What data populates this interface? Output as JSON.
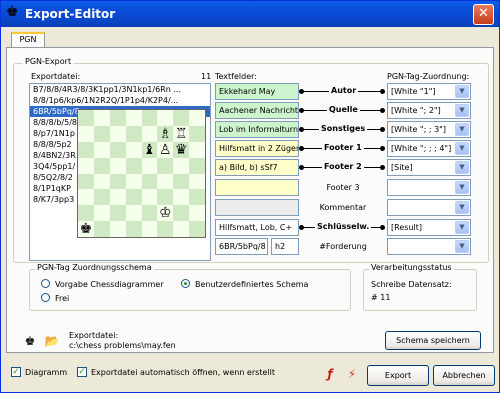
{
  "window": {
    "title": "Export-Editor",
    "close_glyph": "✕",
    "app_icon": "king-icon"
  },
  "tabs": [
    {
      "label": "PGN"
    }
  ],
  "pgn_export": {
    "group_label": "PGN-Export",
    "exportdatei_label": "Exportdatei:",
    "count": "11",
    "files": [
      "B7/8/8/4R3/8/3K1pp1/3N1kp1/6Rn ...",
      "8/8/1p6/kp6/1N2R2Q/1P1p4/K2P4/...",
      "6BR/5bPq/8",
      "8/8/8/b/5/8",
      "8/p7/1N1p",
      "8/8/8/5p2",
      "8/4BN2/3R",
      "3Q4/5pp1/",
      "8/5Q2/8/2",
      "8/1P1qKP",
      "8/K7/3pp3"
    ],
    "selected_index": 2
  },
  "board": {
    "pieces": [
      {
        "square": "f7",
        "glyph": "♗",
        "color": "white"
      },
      {
        "square": "g7",
        "glyph": "♖",
        "color": "white"
      },
      {
        "square": "e6",
        "glyph": "♝",
        "color": "black"
      },
      {
        "square": "f6",
        "glyph": "♙",
        "color": "white"
      },
      {
        "square": "g6",
        "glyph": "♛",
        "color": "black"
      },
      {
        "square": "f2",
        "glyph": "♔",
        "color": "white"
      },
      {
        "square": "a1",
        "glyph": "♚",
        "color": "black"
      }
    ]
  },
  "textfields": {
    "label": "Textfelder:",
    "fields": [
      {
        "value": "Ekkehard May",
        "bg": "green"
      },
      {
        "value": "Aachener Nachricht",
        "bg": "green"
      },
      {
        "value": "Lob im Informalturnie",
        "bg": "green"
      },
      {
        "value": "Hilfsmatt in 2 Zügen",
        "bg": "yellow"
      },
      {
        "value": "a) Bild, b) sSf7",
        "bg": "yellow"
      },
      {
        "value": "",
        "bg": "yellow"
      },
      {
        "value": "",
        "bg": "grey"
      },
      {
        "value": "Hilfsmatt, Lob, C+",
        "bg": "white"
      }
    ],
    "fen": "6BR/5bPq/8",
    "fen_suffix": "h2"
  },
  "tag_mapping": {
    "label": "PGN-Tag-Zuordnung:",
    "rows": [
      {
        "name": "Autor",
        "bold": true,
        "select": "[White \"1\"]"
      },
      {
        "name": "Quelle",
        "bold": true,
        "select": "[White \"; 2\"]"
      },
      {
        "name": "Sonstiges",
        "bold": true,
        "select": "[White \"; ; 3\"]"
      },
      {
        "name": "Footer 1",
        "bold": true,
        "select": "[White \"; ; ; 4\"]"
      },
      {
        "name": "Footer 2",
        "bold": true,
        "select": "[Site]"
      },
      {
        "name": "Footer 3",
        "bold": false,
        "select": ""
      },
      {
        "name": "Kommentar",
        "bold": false,
        "select": ""
      },
      {
        "name": "Schlüsselw.",
        "bold": true,
        "select": "[Result]"
      },
      {
        "name": "#Forderung",
        "bold": false,
        "select": ""
      }
    ]
  },
  "schema": {
    "group_label": "PGN-Tag Zuordnungsschema",
    "options": [
      {
        "label": "Vorgabe Chessdiagrammer",
        "checked": false
      },
      {
        "label": "Benutzerdefiniertes Schema",
        "checked": true
      },
      {
        "label": "Frei",
        "checked": false
      }
    ]
  },
  "status": {
    "group_label": "Verarbeitungsstatus",
    "line1": "Schreibe Datensatz:",
    "line2": "# 11"
  },
  "export_file": {
    "label": "Exportdatei:",
    "path": "c:\\chess problems\\may.fen"
  },
  "buttons": {
    "save_schema": "Schema speichern",
    "export": "Export",
    "cancel": "Abbrechen"
  },
  "checkboxes": {
    "diagram": {
      "label": "Diagramm",
      "checked": true
    },
    "autoopen": {
      "label": "Exportdatei automatisch öffnen, wenn erstellt",
      "checked": true
    }
  }
}
